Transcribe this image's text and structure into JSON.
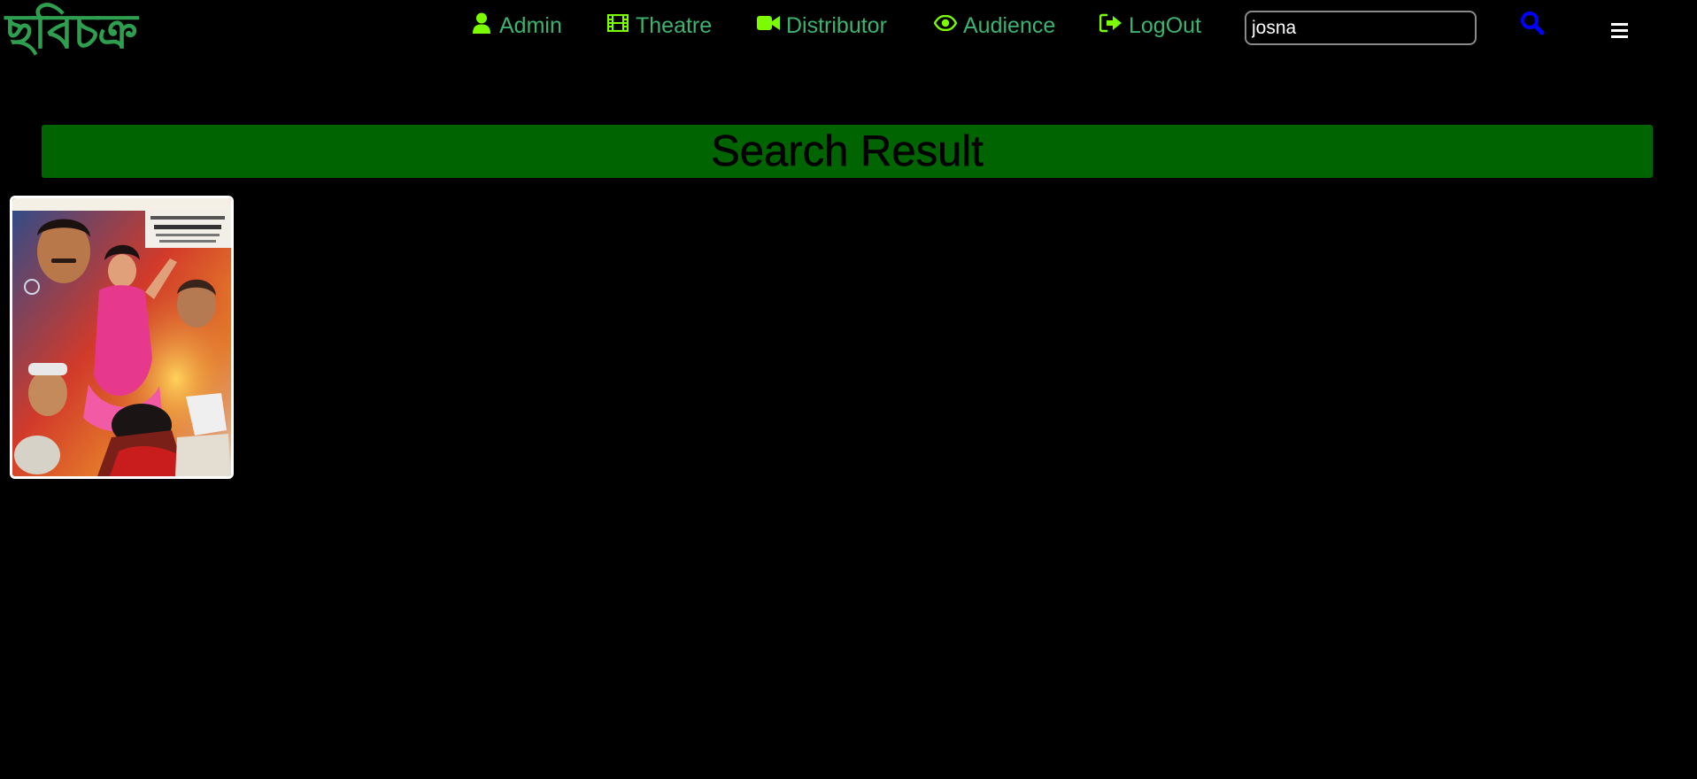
{
  "header": {
    "logo_text": "ছবিচক্র",
    "nav": [
      {
        "label": "Admin",
        "icon": "user-icon"
      },
      {
        "label": "Theatre",
        "icon": "film-icon"
      },
      {
        "label": "Distributor",
        "icon": "video-camera-icon"
      },
      {
        "label": "Audience",
        "icon": "eye-icon"
      },
      {
        "label": "LogOut",
        "icon": "sign-out-icon"
      }
    ],
    "search": {
      "value": "josna",
      "placeholder": ""
    },
    "search_icon": "search-icon",
    "menu_icon": "hamburger-menu-icon"
  },
  "main": {
    "banner_title": "Search Result",
    "results": [
      {
        "poster_alt": "movie poster"
      }
    ]
  },
  "colors": {
    "background": "#000000",
    "logo": "#2e9e4f",
    "nav_text": "#3cb371",
    "nav_icon": "#7cfc00",
    "banner": "#006400",
    "search_icon": "#0000ff",
    "card_border": "#ffffff"
  }
}
